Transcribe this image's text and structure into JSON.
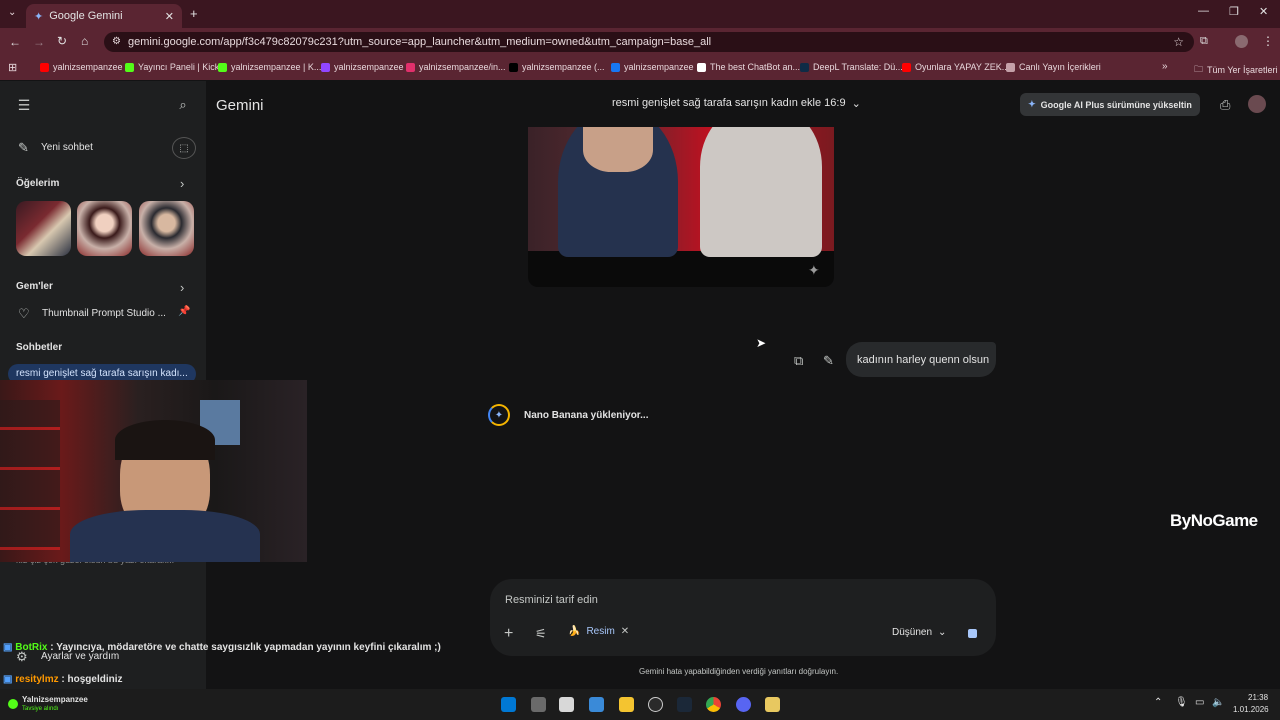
{
  "browser": {
    "tab_title": "Google Gemini",
    "url": "gemini.google.com/app/f3c479c82079c231?utm_source=app_launcher&utm_medium=owned&utm_campaign=base_all",
    "bookmarks": [
      {
        "label": "yalnizsempanzee",
        "color": "#ff0000"
      },
      {
        "label": "Yayıncı Paneli | Kick",
        "color": "#53fc18"
      },
      {
        "label": "yalnizsempanzee | K...",
        "color": "#53fc18"
      },
      {
        "label": "yalnizsempanzee",
        "color": "#9146ff"
      },
      {
        "label": "yalnizsempanzee/in...",
        "color": "#e1306c"
      },
      {
        "label": "yalnizsempanzee (...",
        "color": "#000000"
      },
      {
        "label": "yalnizsempanzee",
        "color": "#1877f2"
      },
      {
        "label": "The best ChatBot an...",
        "color": "#ffffff"
      },
      {
        "label": "DeepL Translate: Dü...",
        "color": "#0f2b46"
      },
      {
        "label": "Oyunlara YAPAY ZEK...",
        "color": "#ff0000"
      },
      {
        "label": "Canlı Yayın İçerikleri",
        "color": "#c4a0a8"
      }
    ],
    "all_bookmarks": "Tüm Yer İşaretleri"
  },
  "sidebar": {
    "new_chat": "Yeni sohbet",
    "my_items": "Öğelerim",
    "gems": "Gem'ler",
    "gem_item": "Thumbnail Prompt Studio ...",
    "chats": "Sohbetler",
    "active_chat": "resmi genişlet sağ tarafa sarışın kadı...",
    "partial_chat": "kız çiz çok güzel olsun bu yazı okarak...",
    "settings": "Ayarlar ve yardım"
  },
  "header": {
    "app_name": "Gemini",
    "chat_title": "resmi genişlet sağ tarafa sarışın kadın ekle 16:9",
    "upgrade": "Google AI Plus sürümüne yükseltin"
  },
  "conversation": {
    "user_message": "kadının harley quenn olsun",
    "loading": "Nano Banana yükleniyor..."
  },
  "composer": {
    "placeholder": "Resminizi tarif edin",
    "chip": "Resim",
    "mode": "Düşünen",
    "disclaimer": "Gemini hata yapabildiğinden verdiği yanıtları doğrulayın."
  },
  "watermark": "ByNoGame",
  "chat_overlay": [
    {
      "user": "BotRix",
      "user_color": "#53fc18",
      "message": "Yayıncıya, mödaretöre ve chatte saygısızlık yapmadan yayının keyfini çıkaralım ;)"
    },
    {
      "user": "resitylmz",
      "user_color": "#ff9900",
      "message": "hoşgeldiniz"
    }
  ],
  "taskbar": {
    "streamer": "Yalnizsempanzee",
    "streamer_status": "Tavsiye alındı",
    "time": "21:38",
    "date": "1.01.2026"
  }
}
